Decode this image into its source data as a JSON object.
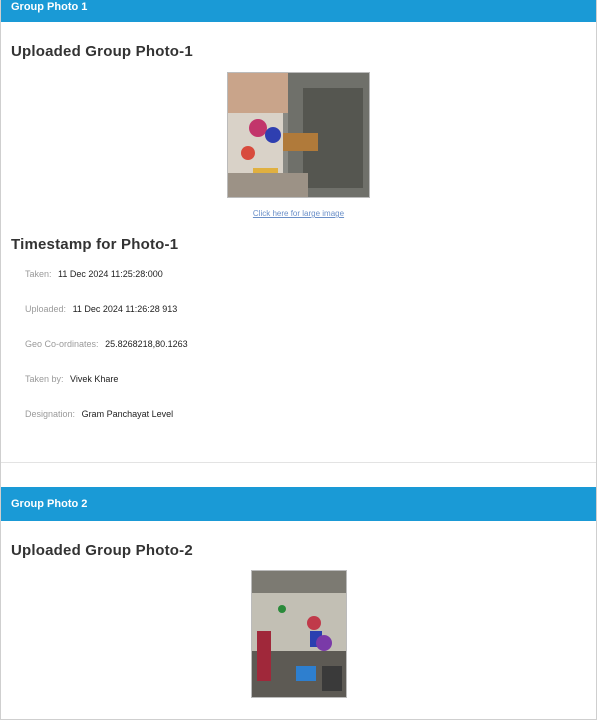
{
  "section1": {
    "header": "Group Photo 1",
    "title": "Uploaded Group Photo-1",
    "photo_link": "Click here for large image",
    "timestamp_title": "Timestamp for Photo-1",
    "fields": [
      {
        "label": "Taken:",
        "value": "11 Dec 2024 11:25:28:000"
      },
      {
        "label": "Uploaded:",
        "value": "11 Dec 2024 11:26:28 913"
      },
      {
        "label": "Geo Co-ordinates:",
        "value": "25.8268218,80.1263"
      },
      {
        "label": "Taken by:",
        "value": "Vivek Khare"
      },
      {
        "label": "Designation:",
        "value": "Gram Panchayat Level"
      }
    ]
  },
  "section2": {
    "header": "Group Photo 2",
    "title": "Uploaded Group Photo-2"
  },
  "colors": {
    "header_bg": "#1a9ad6",
    "link": "#6a8fc8",
    "label": "#9a9a9a"
  }
}
